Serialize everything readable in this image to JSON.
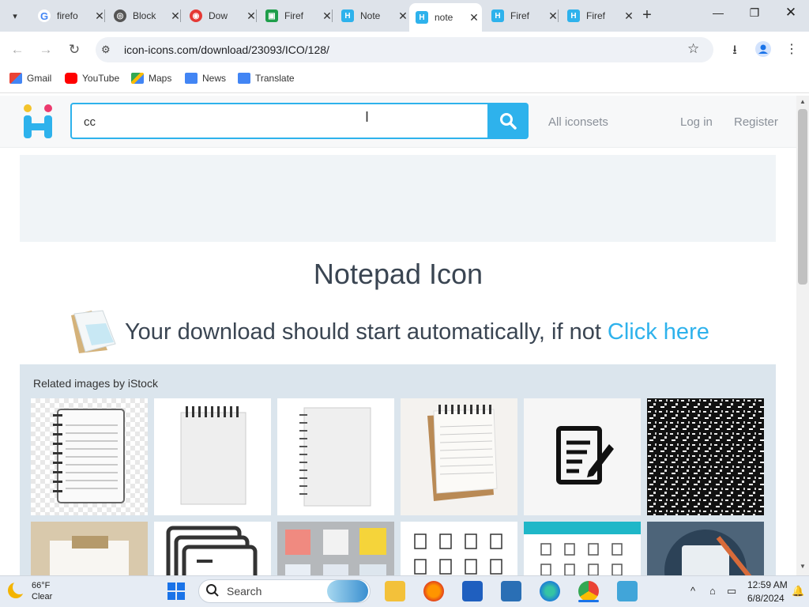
{
  "browser": {
    "tabs": [
      {
        "label": "firefo",
        "icon": "google-icon",
        "active": false
      },
      {
        "label": "Block",
        "icon": "globe-icon",
        "active": false
      },
      {
        "label": "Dow",
        "icon": "download-site-icon",
        "active": false
      },
      {
        "label": "Firef",
        "icon": "green-sheet-icon",
        "active": false
      },
      {
        "label": "Note",
        "icon": "icon-icons-logo-icon",
        "active": false
      },
      {
        "label": "note",
        "icon": "icon-icons-logo-icon",
        "active": true
      },
      {
        "label": "Firef",
        "icon": "icon-icons-logo-icon",
        "active": false
      },
      {
        "label": "Firef",
        "icon": "icon-icons-logo-icon",
        "active": false
      }
    ],
    "url": "icon-icons.com/download/23093/ICO/128/",
    "bookmarks": [
      {
        "label": "Gmail",
        "icon": "gmail-icon"
      },
      {
        "label": "YouTube",
        "icon": "youtube-icon"
      },
      {
        "label": "Maps",
        "icon": "maps-icon"
      },
      {
        "label": "News",
        "icon": "news-icon"
      },
      {
        "label": "Translate",
        "icon": "translate-icon"
      }
    ]
  },
  "site": {
    "search_value": "cc",
    "nav": {
      "all_iconsets": "All iconsets",
      "login": "Log in",
      "register": "Register"
    },
    "title": "Notepad Icon",
    "download_text": "Your download should start automatically, if not",
    "download_link": "Click here",
    "related_title": "Related images by iStock",
    "accent_color": "#2eb2ec"
  },
  "taskbar": {
    "weather_temp": "66°F",
    "weather_cond": "Clear",
    "search_label": "Search",
    "time": "12:59 AM",
    "date": "6/8/2024"
  }
}
